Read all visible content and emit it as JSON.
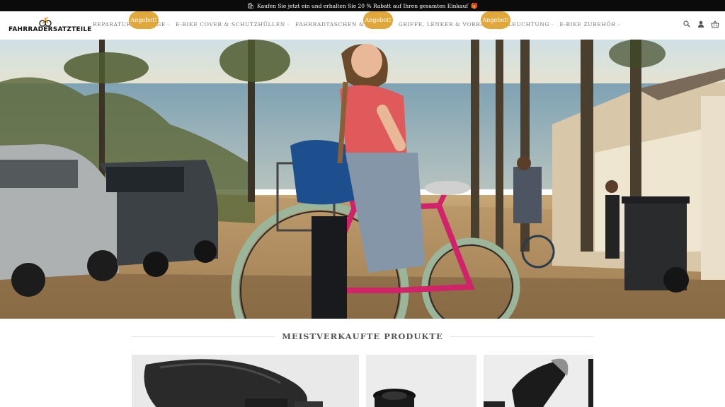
{
  "topbar": {
    "icon_left": "shopping-bag-icon",
    "text": "Kaufen Sie jetzt ein und erhalten Sie 20 % Rabatt auf Ihren gesamten Einkauf",
    "icon_right": "gift-icon"
  },
  "header": {
    "logo_text": "FAHRRADERSATZTEILE",
    "nav": [
      {
        "label": "REPARATUR & PFLEGE"
      },
      {
        "label": "E-BIKE COVER & SCHUTZHÜLLEN"
      },
      {
        "label": "FAHRRADTASCHEN & KÖRBE"
      },
      {
        "label": "GRIFFE, LENKER & VORBAU"
      },
      {
        "label": "BELEUCHTUNG"
      },
      {
        "label": "E-BIKE ZUBEHÖR"
      }
    ],
    "icons": [
      "search-icon",
      "user-icon",
      "basket-icon"
    ]
  },
  "main": {
    "section_title": "MEISTVERKAUFTE PRODUKTE",
    "products": [
      {
        "badge": "Angebot!"
      },
      {
        "badge": "Angebot!"
      },
      {
        "badge": "Angebot!"
      }
    ]
  },
  "colors": {
    "topbar_bg": "#0b0b0b",
    "badge": "#e0a73c",
    "nav_text": "#777777"
  }
}
